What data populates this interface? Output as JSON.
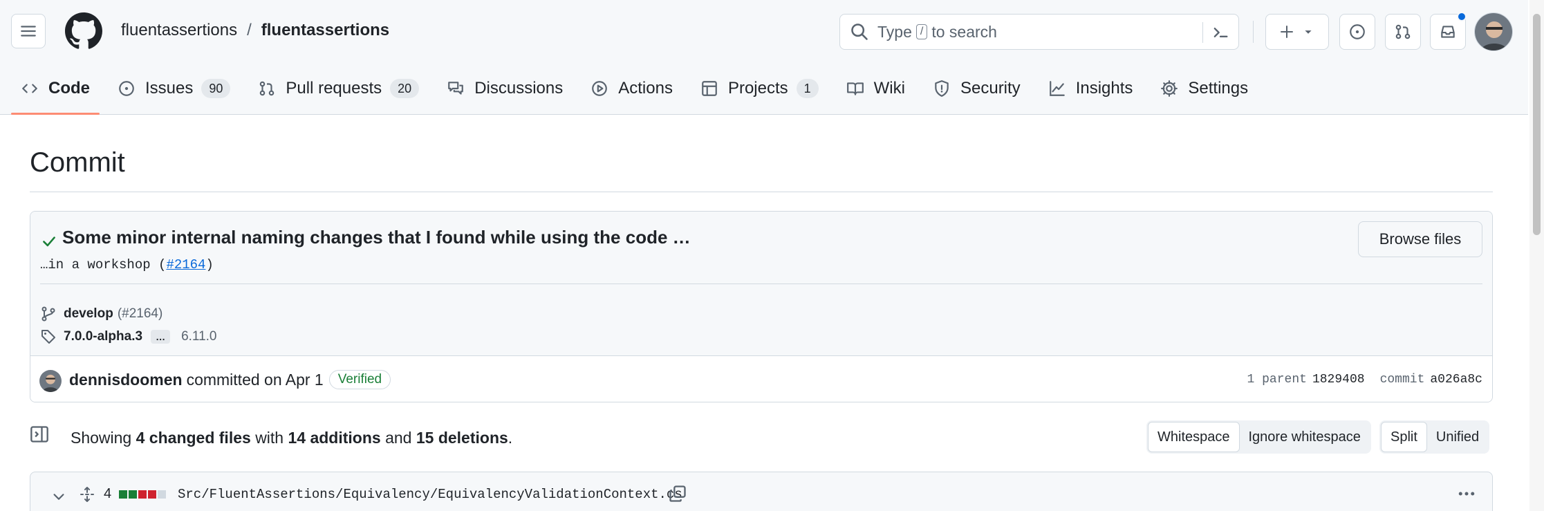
{
  "header": {
    "owner": "fluentassertions",
    "separator": "/",
    "repo": "fluentassertions",
    "search": {
      "placeholder_pre": "Type",
      "key": "/",
      "placeholder_post": "to search"
    }
  },
  "tabs": [
    {
      "label": "Code",
      "icon": "code-icon",
      "active": true
    },
    {
      "label": "Issues",
      "icon": "issue-icon",
      "count": "90"
    },
    {
      "label": "Pull requests",
      "icon": "pull-request-icon",
      "count": "20"
    },
    {
      "label": "Discussions",
      "icon": "discussions-icon"
    },
    {
      "label": "Actions",
      "icon": "play-icon"
    },
    {
      "label": "Projects",
      "icon": "table-icon",
      "count": "1"
    },
    {
      "label": "Wiki",
      "icon": "book-icon"
    },
    {
      "label": "Security",
      "icon": "shield-icon"
    },
    {
      "label": "Insights",
      "icon": "graph-icon"
    },
    {
      "label": "Settings",
      "icon": "gear-icon"
    }
  ],
  "page": {
    "title": "Commit"
  },
  "commit": {
    "title": "Some minor internal naming changes that I found while using the code …",
    "desc_pre": "…in a workshop (",
    "desc_link": "#2164",
    "desc_post": ")",
    "browse_label": "Browse files",
    "branch": "develop",
    "branch_pr": "(#2164)",
    "tag": "7.0.0-alpha.3",
    "tag_more": "…",
    "tag_old": "6.11.0",
    "author": "dennisdoomen",
    "action": "committed on Apr 1",
    "verified": "Verified",
    "parent_label": "1 parent",
    "parent_hash": "1829408",
    "commit_label": "commit",
    "commit_hash": "a026a8c"
  },
  "summary": {
    "pre": "Showing",
    "files": "4 changed files",
    "mid1": "with",
    "additions": "14 additions",
    "mid2": "and",
    "deletions": "15 deletions",
    "post": "."
  },
  "toggles": {
    "whitespace": "Whitespace",
    "ignore_whitespace": "Ignore whitespace",
    "split": "Split",
    "unified": "Unified"
  },
  "file": {
    "changes": "4",
    "path": "Src/FluentAssertions/Equivalency/EquivalencyValidationContext.cs"
  },
  "colors": {
    "accent": "#fd8c73",
    "link": "#0969da",
    "success": "#1a7f37",
    "deletion": "#cf222e"
  }
}
